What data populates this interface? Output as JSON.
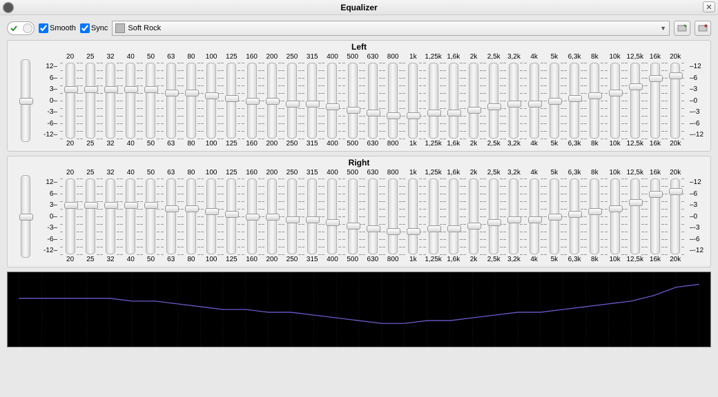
{
  "window": {
    "title": "Equalizer"
  },
  "toolbar": {
    "enable_on": true,
    "smooth_label": "Smooth",
    "smooth_checked": true,
    "sync_label": "Sync",
    "sync_checked": true,
    "preset": "Soft Rock"
  },
  "scale": {
    "ticks": [
      "12",
      "6",
      "3",
      "0",
      "-3",
      "-6",
      "-12"
    ]
  },
  "bands": [
    "20",
    "25",
    "32",
    "40",
    "50",
    "63",
    "80",
    "100",
    "125",
    "160",
    "200",
    "250",
    "315",
    "400",
    "500",
    "630",
    "800",
    "1k",
    "1,25k",
    "1,6k",
    "2k",
    "2,5k",
    "3,2k",
    "4k",
    "5k",
    "6,3k",
    "8k",
    "10k",
    "12,5k",
    "16k",
    "20k"
  ],
  "channels": {
    "left": {
      "title": "Left",
      "master": 0,
      "values": [
        4,
        4,
        4,
        4,
        4,
        3,
        3,
        2,
        1,
        0,
        0,
        -1,
        -1,
        -2,
        -3,
        -4,
        -5,
        -5,
        -4,
        -4,
        -3,
        -2,
        -1,
        -1,
        0,
        1,
        2,
        3,
        5,
        8,
        9
      ]
    },
    "right": {
      "title": "Right",
      "master": 0,
      "values": [
        4,
        4,
        4,
        4,
        4,
        3,
        3,
        2,
        1,
        0,
        0,
        -1,
        -1,
        -2,
        -3,
        -4,
        -5,
        -5,
        -4,
        -4,
        -3,
        -2,
        -1,
        -1,
        0,
        1,
        2,
        3,
        5,
        8,
        9
      ]
    }
  },
  "slider_range": {
    "min": -12,
    "max": 12
  },
  "curve_color": "#6a5acd"
}
